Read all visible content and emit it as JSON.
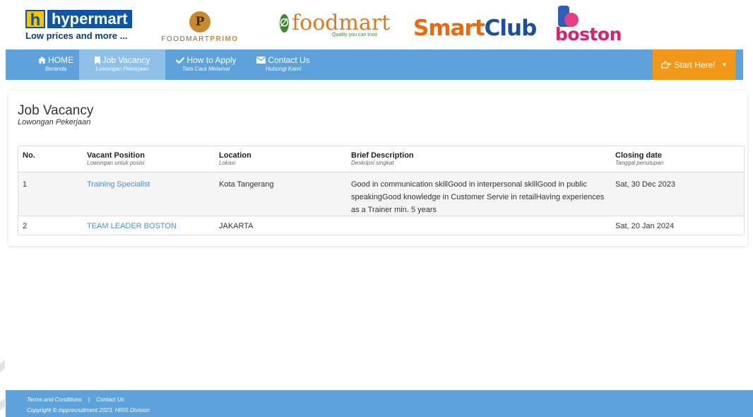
{
  "logos": {
    "hypermart": {
      "letter": "h",
      "word": "hypermart",
      "tagline": "Low prices and more ..."
    },
    "foodmart_primo": {
      "seal": "P",
      "text_a": "FOODMART",
      "text_b": "PRIMO"
    },
    "foodmart": {
      "symbol": "∅",
      "word": "foodmart",
      "tagline": "Quality you can trust"
    },
    "smartclub": {
      "part1": "Smart",
      "part2": "Club"
    },
    "boston": {
      "word": "boston"
    }
  },
  "nav": {
    "items": [
      {
        "label": "HOME",
        "sub": "Beranda",
        "icon": "home-icon"
      },
      {
        "label": "Job Vacancy",
        "sub": "Lowongan Pekerjaan",
        "icon": "bookmark-icon"
      },
      {
        "label": "How to Apply",
        "sub": "Tata Cara Melamar",
        "icon": "check-icon"
      },
      {
        "label": "Contact Us",
        "sub": "Hubungi Kami",
        "icon": "envelope-icon"
      }
    ],
    "cta_label": "Start Here!"
  },
  "page": {
    "title": "Job Vacancy",
    "subtitle": "Lowongan Pekerjaan"
  },
  "table": {
    "headers": [
      {
        "label": "No.",
        "sub": ""
      },
      {
        "label": "Vacant Position",
        "sub": "Lowongan untuk posisi"
      },
      {
        "label": "Location",
        "sub": "Lokasi"
      },
      {
        "label": "Brief Description",
        "sub": "Deskripsi singkat"
      },
      {
        "label": "Closing date",
        "sub": "Tanggal penutupan"
      }
    ],
    "rows": [
      {
        "no": "1",
        "position": "Training Specialist",
        "location": "Kota Tangerang",
        "description": "Good in communication skillGood in interpersonal skillGood in public speakingGood knowledge in Customer Servie in retailHaving experiences as a Trainer min. 5 years",
        "closing": "Sat, 30 Dec 2023"
      },
      {
        "no": "2",
        "position": "TEAM LEADER BOSTON",
        "location": "JAKARTA",
        "description": "",
        "closing": "Sat, 20 Jan 2024"
      }
    ]
  },
  "footer": {
    "terms": "Terms and Conditions",
    "separator": "|",
    "contact": "Contact Us",
    "copyright": "Copyright © mpprecruitment 2023, HRIS Division"
  },
  "colors": {
    "nav_bg": "#5ea2dc",
    "nav_active": "#8fc0ea",
    "cta": "#f39718",
    "link": "#4a8fd2"
  }
}
